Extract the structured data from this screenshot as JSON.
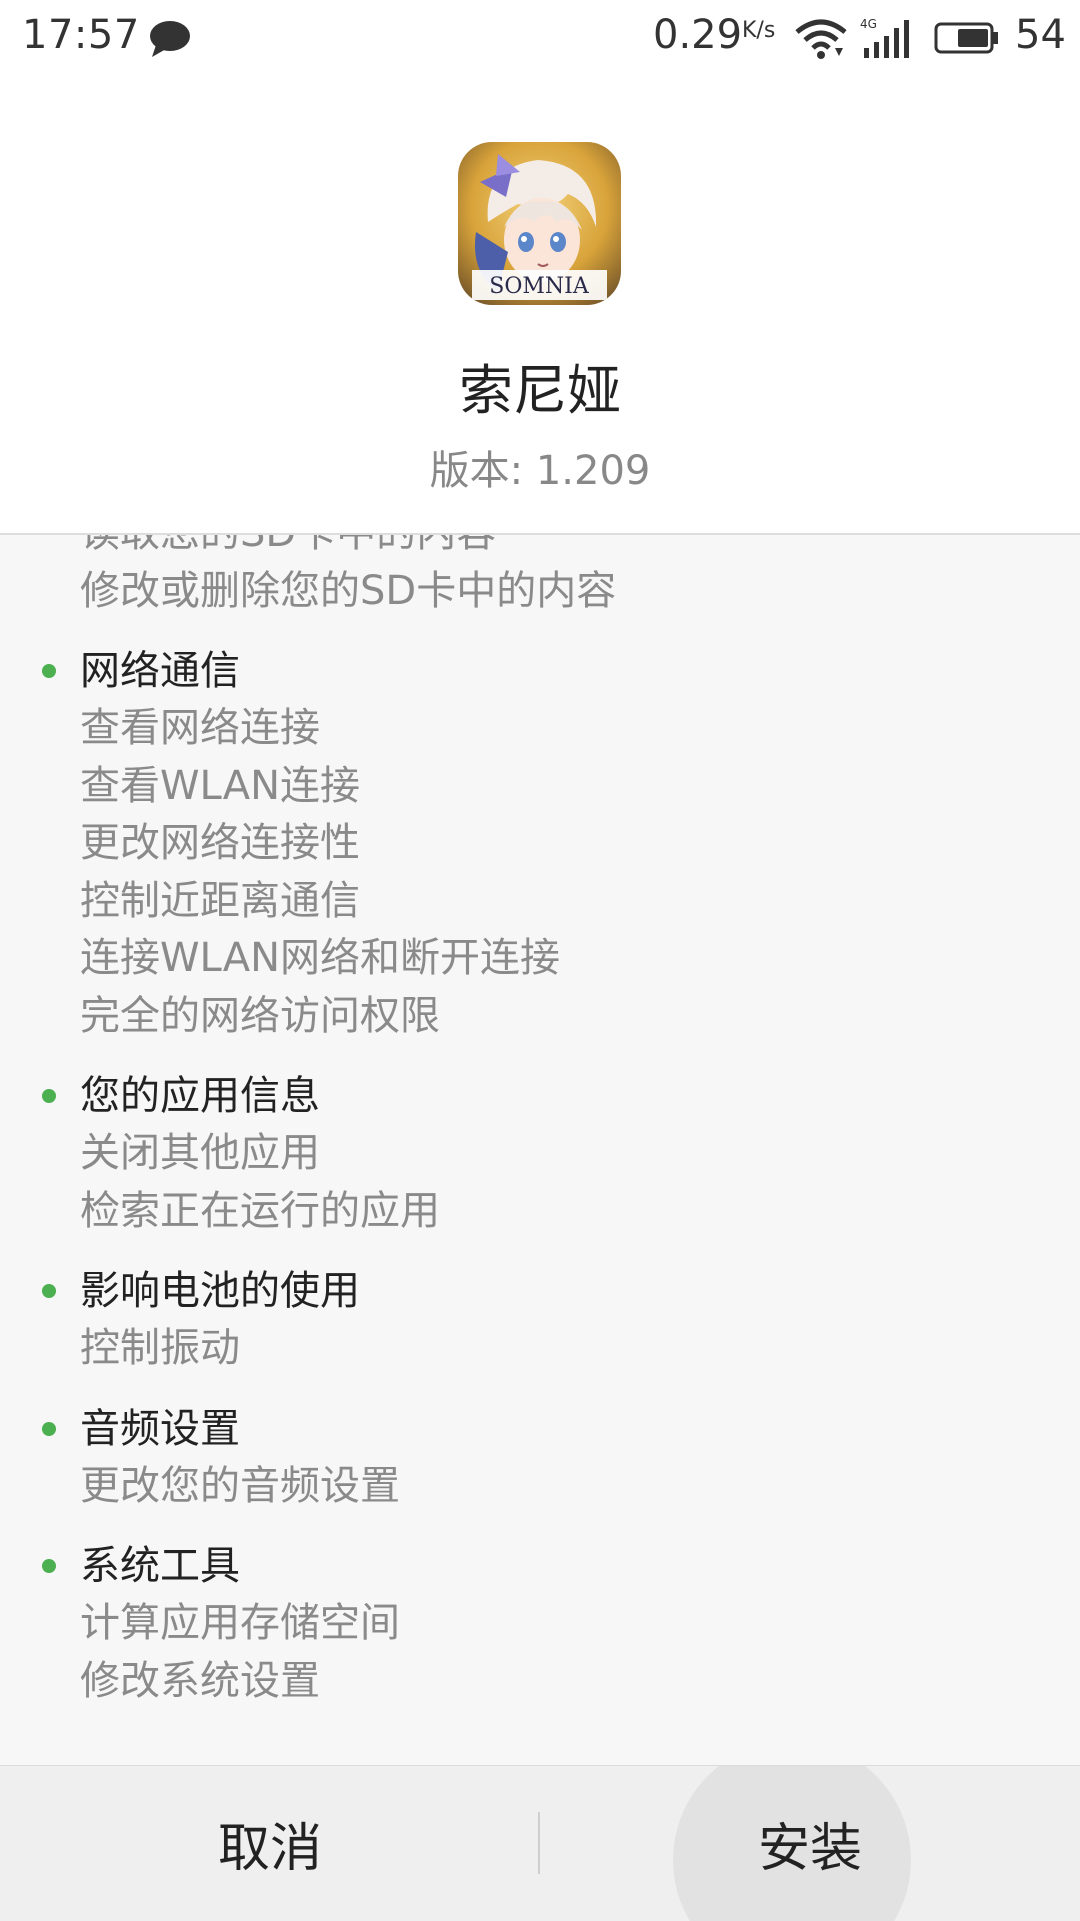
{
  "status_bar": {
    "time": "17:57",
    "net_speed": "0.29",
    "net_unit": "K/s",
    "network_type": "4G",
    "battery": "54"
  },
  "header": {
    "app_name": "索尼娅",
    "version": "版本: 1.209",
    "icon_text": "SOMNIA"
  },
  "permissions": {
    "partial_top": [
      "读取您的SD卡中的内容",
      "修改或删除您的SD卡中的内容"
    ],
    "groups": [
      {
        "title": "网络通信",
        "items": [
          "查看网络连接",
          "查看WLAN连接",
          "更改网络连接性",
          "控制近距离通信",
          "连接WLAN网络和断开连接",
          "完全的网络访问权限"
        ]
      },
      {
        "title": "您的应用信息",
        "items": [
          "关闭其他应用",
          "检索正在运行的应用"
        ]
      },
      {
        "title": "影响电池的使用",
        "items": [
          "控制振动"
        ]
      },
      {
        "title": "音频设置",
        "items": [
          "更改您的音频设置"
        ]
      },
      {
        "title": "系统工具",
        "items": [
          "计算应用存储空间",
          "修改系统设置"
        ]
      }
    ]
  },
  "buttons": {
    "cancel": "取消",
    "install": "安装"
  },
  "colors": {
    "bullet": "#4caf50",
    "list_bg": "#f7f7f7",
    "bottom_bg": "#efefef"
  }
}
